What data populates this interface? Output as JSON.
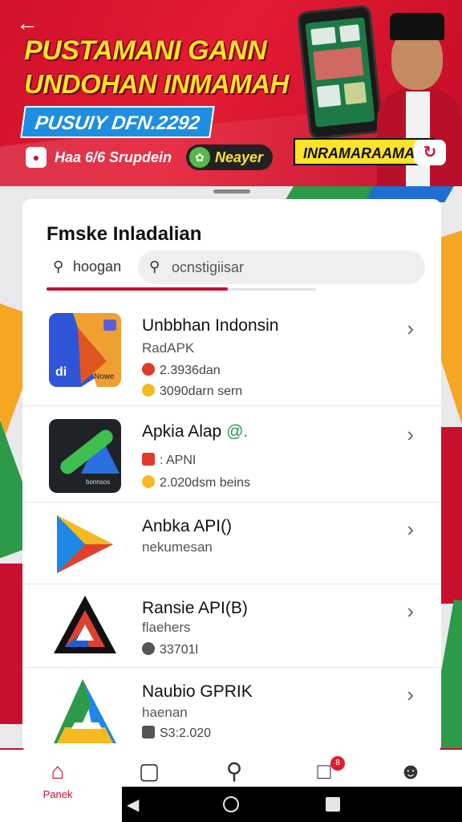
{
  "banner": {
    "headline_line1": "PUSTAMANI GANN",
    "headline_line2": "UNDOHAN INMAMAH",
    "promo_code": "PUSUIY DFN.2292",
    "chip1_label": "Haa 6/6 Srupdein",
    "chip2_label": "Neayer",
    "tag_label": "INRAMARAAMAN"
  },
  "card": {
    "title": "Fmske Inladalian",
    "search_left_text": "hoogan",
    "search_placeholder": "ocnstigiisar"
  },
  "apps": [
    {
      "name": "Unbbhan Indonsin",
      "subtitle": "RadAPK",
      "meta": [
        "2.3936dan",
        "3090darn sern"
      ],
      "thumb_text": [
        "di",
        "Nowe"
      ]
    },
    {
      "name": "Apkia Alap",
      "name_badge": "@.",
      "subtitle": "",
      "meta": [
        ": APNI",
        "2.020dsm beins"
      ],
      "thumb_text": [
        "bonnsos"
      ]
    },
    {
      "name": "Anbka API()",
      "subtitle": "nekumesan",
      "meta": []
    },
    {
      "name": "Ransie API(B)",
      "subtitle": "flaehers",
      "meta": [
        "33701l"
      ]
    },
    {
      "name": "Naubio GPRIK",
      "subtitle": "haenan",
      "meta": [
        "S3:2.020"
      ]
    }
  ],
  "bottom_nav": {
    "home_label": "Panek",
    "badge_count": "8"
  },
  "colors": {
    "brand_red": "#c8102e",
    "headline_yellow": "#ffe22a",
    "promo_blue": "#1e8ee0"
  }
}
